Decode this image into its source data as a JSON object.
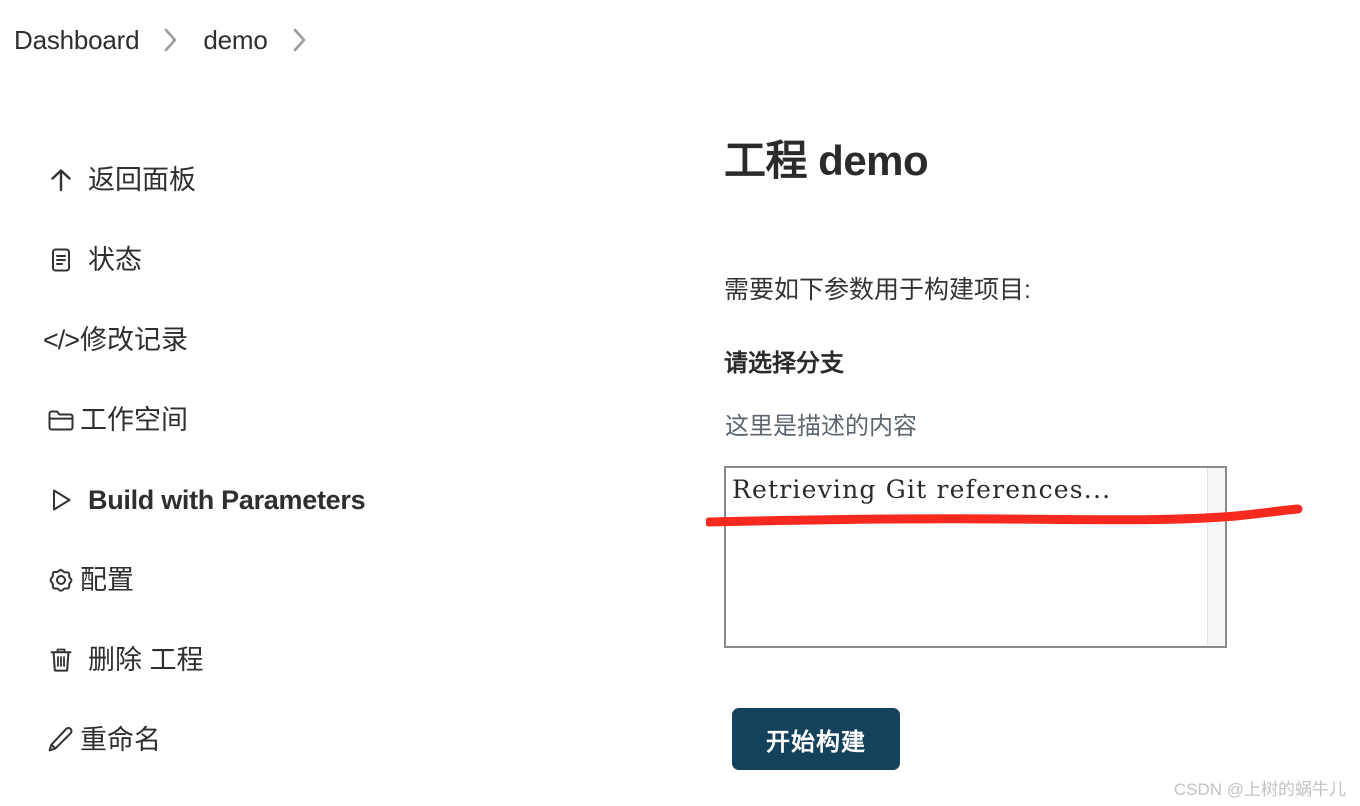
{
  "breadcrumb": {
    "items": [
      {
        "label": "Dashboard"
      },
      {
        "label": "demo"
      }
    ],
    "separator_icon": "chevron-right-icon"
  },
  "sidebar": {
    "items": [
      {
        "label": "返回面板",
        "icon": "arrow-up-icon"
      },
      {
        "label": "状态",
        "icon": "document-lines-icon"
      },
      {
        "label": "修改记录",
        "icon": "code-icon",
        "icon_glyph": "</>"
      },
      {
        "label": "工作空间",
        "icon": "folder-icon"
      },
      {
        "label": "Build with Parameters",
        "icon": "play-triangle-icon"
      },
      {
        "label": "配置",
        "icon": "gear-icon"
      },
      {
        "label": "删除 工程",
        "icon": "trash-icon"
      },
      {
        "label": "重命名",
        "icon": "pencil-icon"
      }
    ]
  },
  "main": {
    "title": "工程 demo",
    "intro": "需要如下参数用于构建项目:",
    "parameter": {
      "label": "请选择分支",
      "description": "这里是描述的内容",
      "options": [
        "Retrieving Git references..."
      ],
      "selected": "Retrieving Git references..."
    },
    "build_button_label": "开始构建"
  },
  "annotation": {
    "type": "hand-drawn-underline",
    "color": "#f8291e"
  },
  "watermark": {
    "text": "CSDN @上树的蜗牛儿"
  },
  "colors": {
    "button_bg": "#14415c",
    "text_primary": "#2f2f2f",
    "text_muted": "#5d6670",
    "annotation_red": "#f8291e",
    "border_gray": "#8a8a8a"
  }
}
